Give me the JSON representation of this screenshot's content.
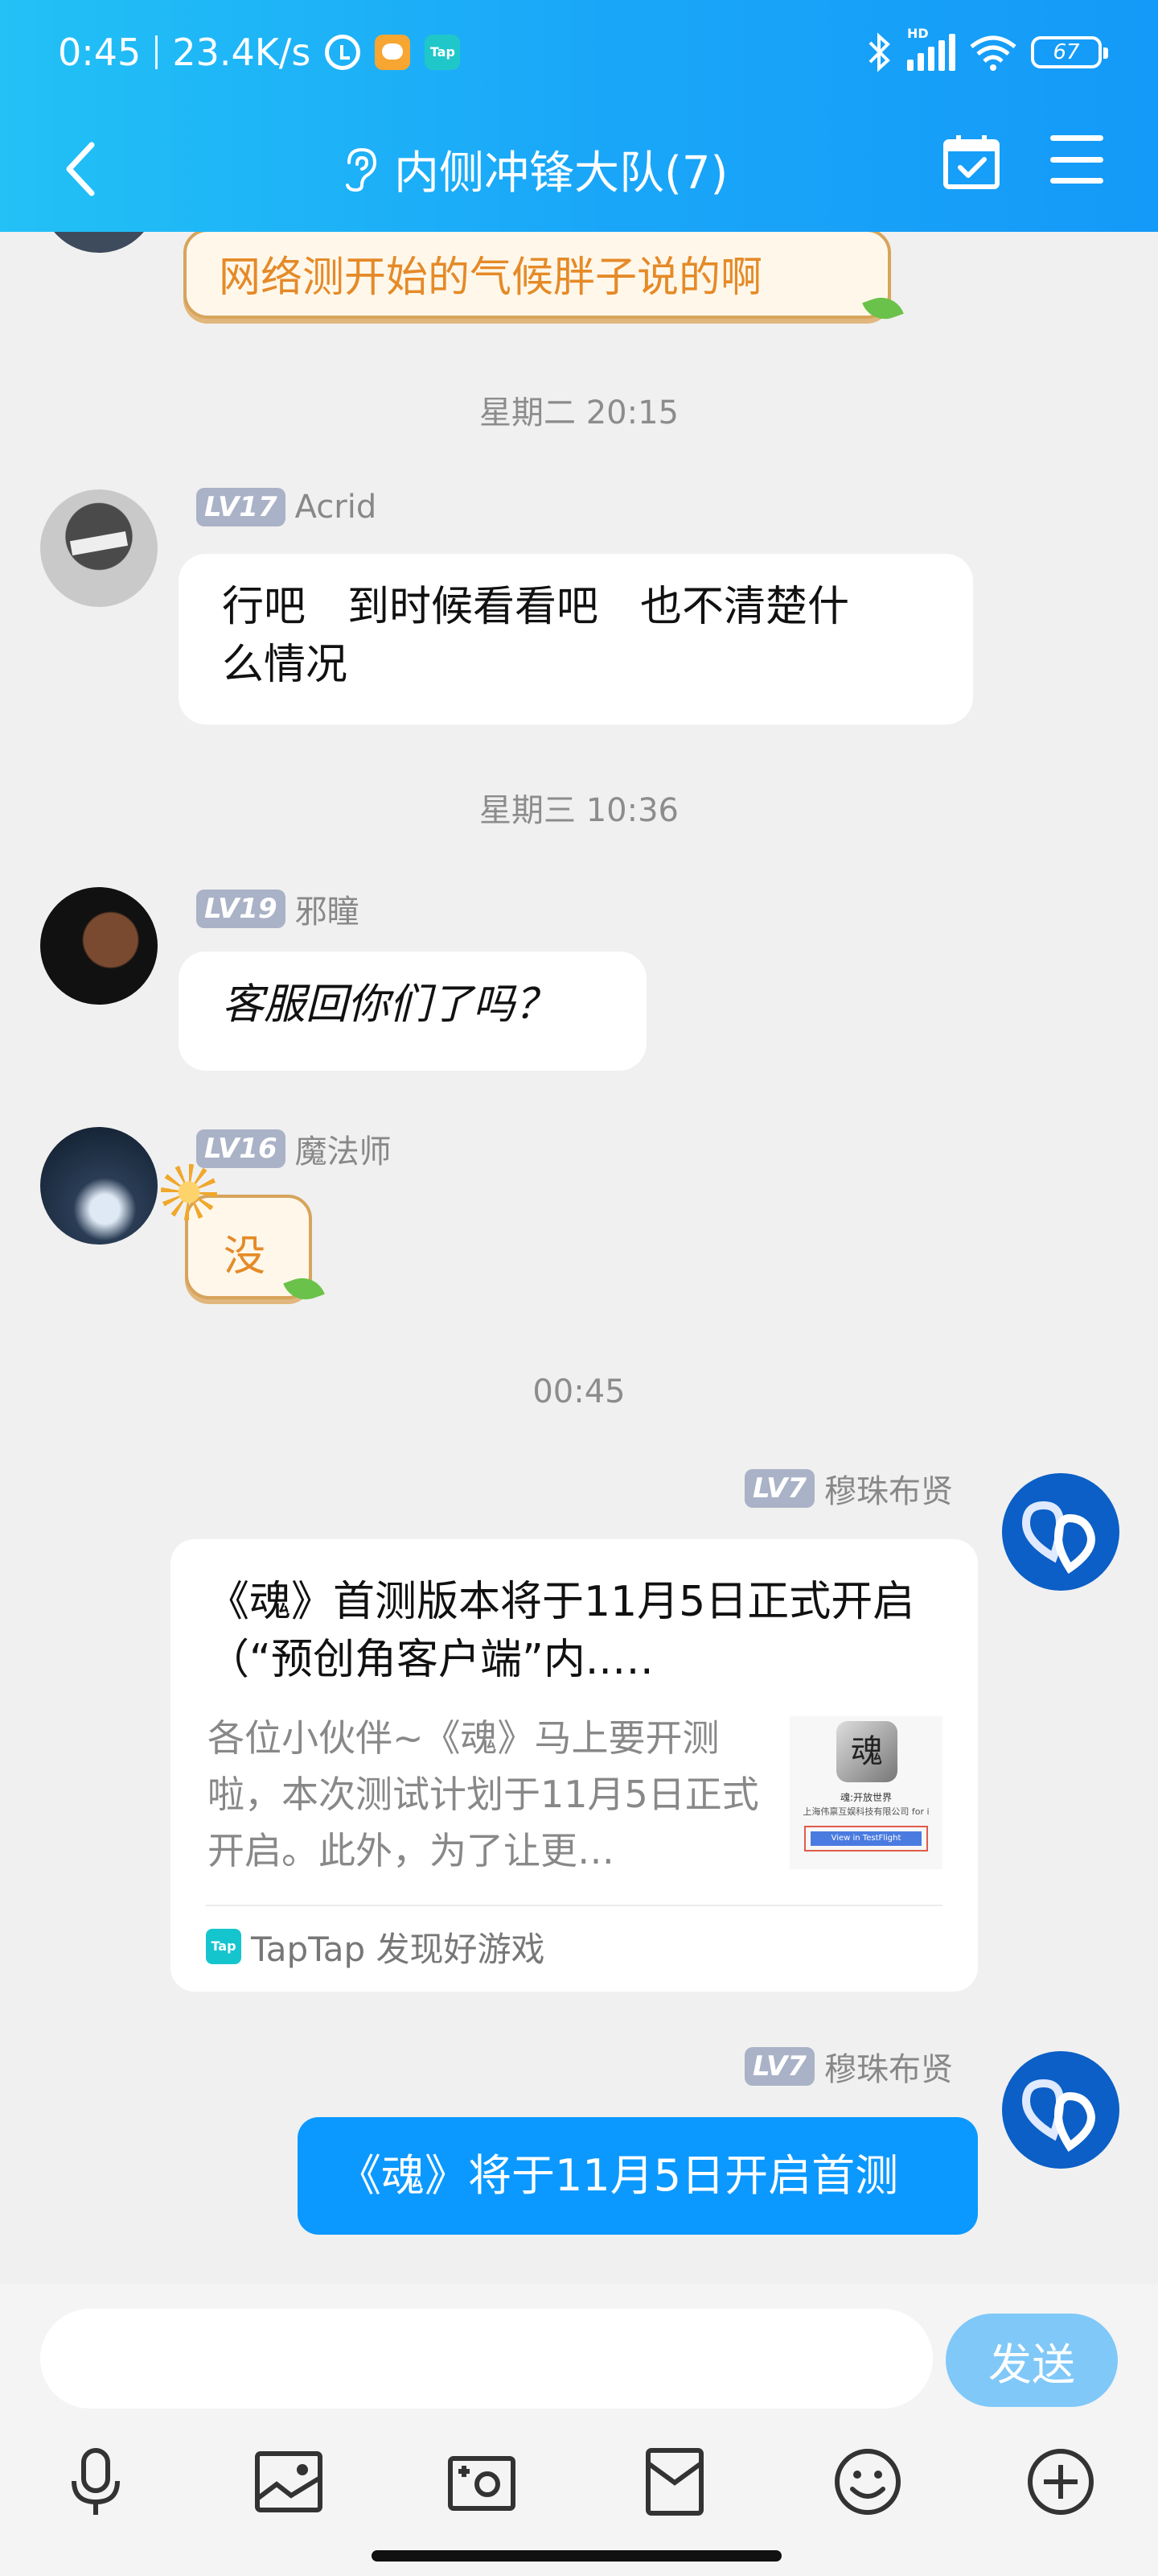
{
  "status_bar": {
    "time": "0:45",
    "speed": "23.4K/s",
    "tap_label": "Tap",
    "hd": "HD",
    "battery": "67"
  },
  "header": {
    "title": "内侧冲锋大队(7)"
  },
  "chat": {
    "top_sticker_text": "网络测开始的气候胖子说的啊",
    "timestamp_1": "星期二 20:15",
    "msg_acrid": {
      "level": "LV17",
      "name": "Acrid",
      "text_line1": "行吧　到时候看看吧　也不清楚什",
      "text_line2": "么情况"
    },
    "timestamp_2": "星期三 10:36",
    "msg_xie": {
      "level": "LV19",
      "name": "邪瞳",
      "text": "客服回你们了吗？"
    },
    "msg_mage": {
      "level": "LV16",
      "name": "魔法师",
      "text": "没"
    },
    "timestamp_3": "00:45",
    "msg_me_card": {
      "level": "LV7",
      "name": "穆珠布贤",
      "card_title": "《魂》首测版本将于11月5日正式开启（“预创角客户端”内..…",
      "card_desc": "各位小伙伴~《魂》马上要开测啦，本次测试计划于11月5日正式开启。此外，为了让更…",
      "thumb_logo": "魂",
      "thumb_line1": "魂:开放世界",
      "thumb_line2": "上海伟禀互娱科技有限公司 for i",
      "thumb_button": "View in TestFlight",
      "source_icon": "Tap",
      "source": "TapTap 发现好游戏"
    },
    "msg_me_text": {
      "level": "LV7",
      "name": "穆珠布贤",
      "text": "《魂》将于11月5日开启首测"
    }
  },
  "input_bar": {
    "placeholder": "",
    "send_label": "发送",
    "tools": [
      "microphone-icon",
      "image-icon",
      "camera-icon",
      "red-packet-icon",
      "emoji-icon",
      "plus-icon"
    ]
  },
  "colors": {
    "header_gradient_start": "#22c1f6",
    "header_gradient_end": "#149af8",
    "bubble_self": "#0b99ff",
    "send_button": "#80c8f8",
    "level_badge": "#a9b2c6"
  }
}
